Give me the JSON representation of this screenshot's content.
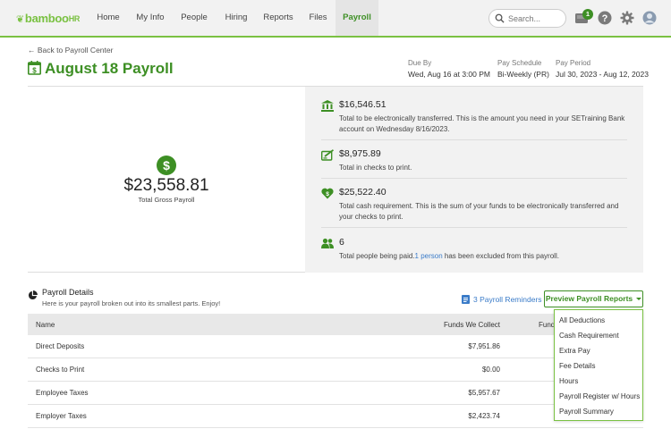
{
  "nav": {
    "logo_main": "bamboo",
    "logo_suffix": "HR",
    "items": [
      {
        "label": "Home"
      },
      {
        "label": "My Info"
      },
      {
        "label": "People"
      },
      {
        "label": "Hiring"
      },
      {
        "label": "Reports"
      },
      {
        "label": "Files"
      },
      {
        "label": "Payroll",
        "active": true
      }
    ],
    "search_placeholder": "Search...",
    "notification_count": "1",
    "icons": [
      "search-icon",
      "inbox-icon",
      "help-icon",
      "gear-icon",
      "avatar"
    ]
  },
  "header": {
    "back_link": "Back to Payroll Center",
    "title": "August 18 Payroll",
    "due_by_label": "Due By",
    "due_by_value": "Wed, Aug 16 at 3:00 PM",
    "pay_schedule_label": "Pay Schedule",
    "pay_schedule_value": "Bi-Weekly (PR)",
    "pay_period_label": "Pay Period",
    "pay_period_value": "Jul 30, 2023 - Aug 12, 2023"
  },
  "summary": {
    "gross_amount": "$23,558.81",
    "gross_label": "Total Gross Payroll",
    "items": [
      {
        "icon": "bank-icon",
        "amount": "$16,546.51",
        "desc": "Total to be electronically transferred. This is the amount you need in your SETraining Bank account on Wednesday 8/16/2023."
      },
      {
        "icon": "check-print-icon",
        "amount": "$8,975.89",
        "desc": "Total in checks to print."
      },
      {
        "icon": "heart-dollar-icon",
        "amount": "$25,522.40",
        "desc": "Total cash requirement. This is the sum of your funds to be electronically transferred and your checks to print."
      },
      {
        "icon": "people-icon",
        "amount": "6",
        "desc_pre": "Total people being paid.",
        "desc_link": "1 person",
        "desc_post": " has been excluded from this payroll."
      }
    ]
  },
  "details": {
    "title": "Payroll Details",
    "subtitle": "Here is your payroll broken out into its smallest parts. Enjoy!",
    "reminders_link": "3 Payroll Reminders",
    "preview_button": "Preview Payroll Reports"
  },
  "table": {
    "headers": [
      "Name",
      "Funds We Collect",
      "Fund"
    ],
    "rows": [
      {
        "name": "Direct Deposits",
        "funds": "$7,951.86"
      },
      {
        "name": "Checks to Print",
        "funds": "$0.00"
      },
      {
        "name": "Employee Taxes",
        "funds": "$5,957.67"
      },
      {
        "name": "Employer Taxes",
        "funds": "$2,423.74"
      }
    ]
  },
  "dropdown": {
    "items": [
      "All Deductions",
      "Cash Requirement",
      "Extra Pay",
      "Fee Details",
      "Hours",
      "Payroll Register w/ Hours",
      "Payroll Summary"
    ]
  },
  "colors": {
    "brand_green": "#3d8f24",
    "logo_green": "#7ac142",
    "link_blue": "#3a7bc8"
  }
}
